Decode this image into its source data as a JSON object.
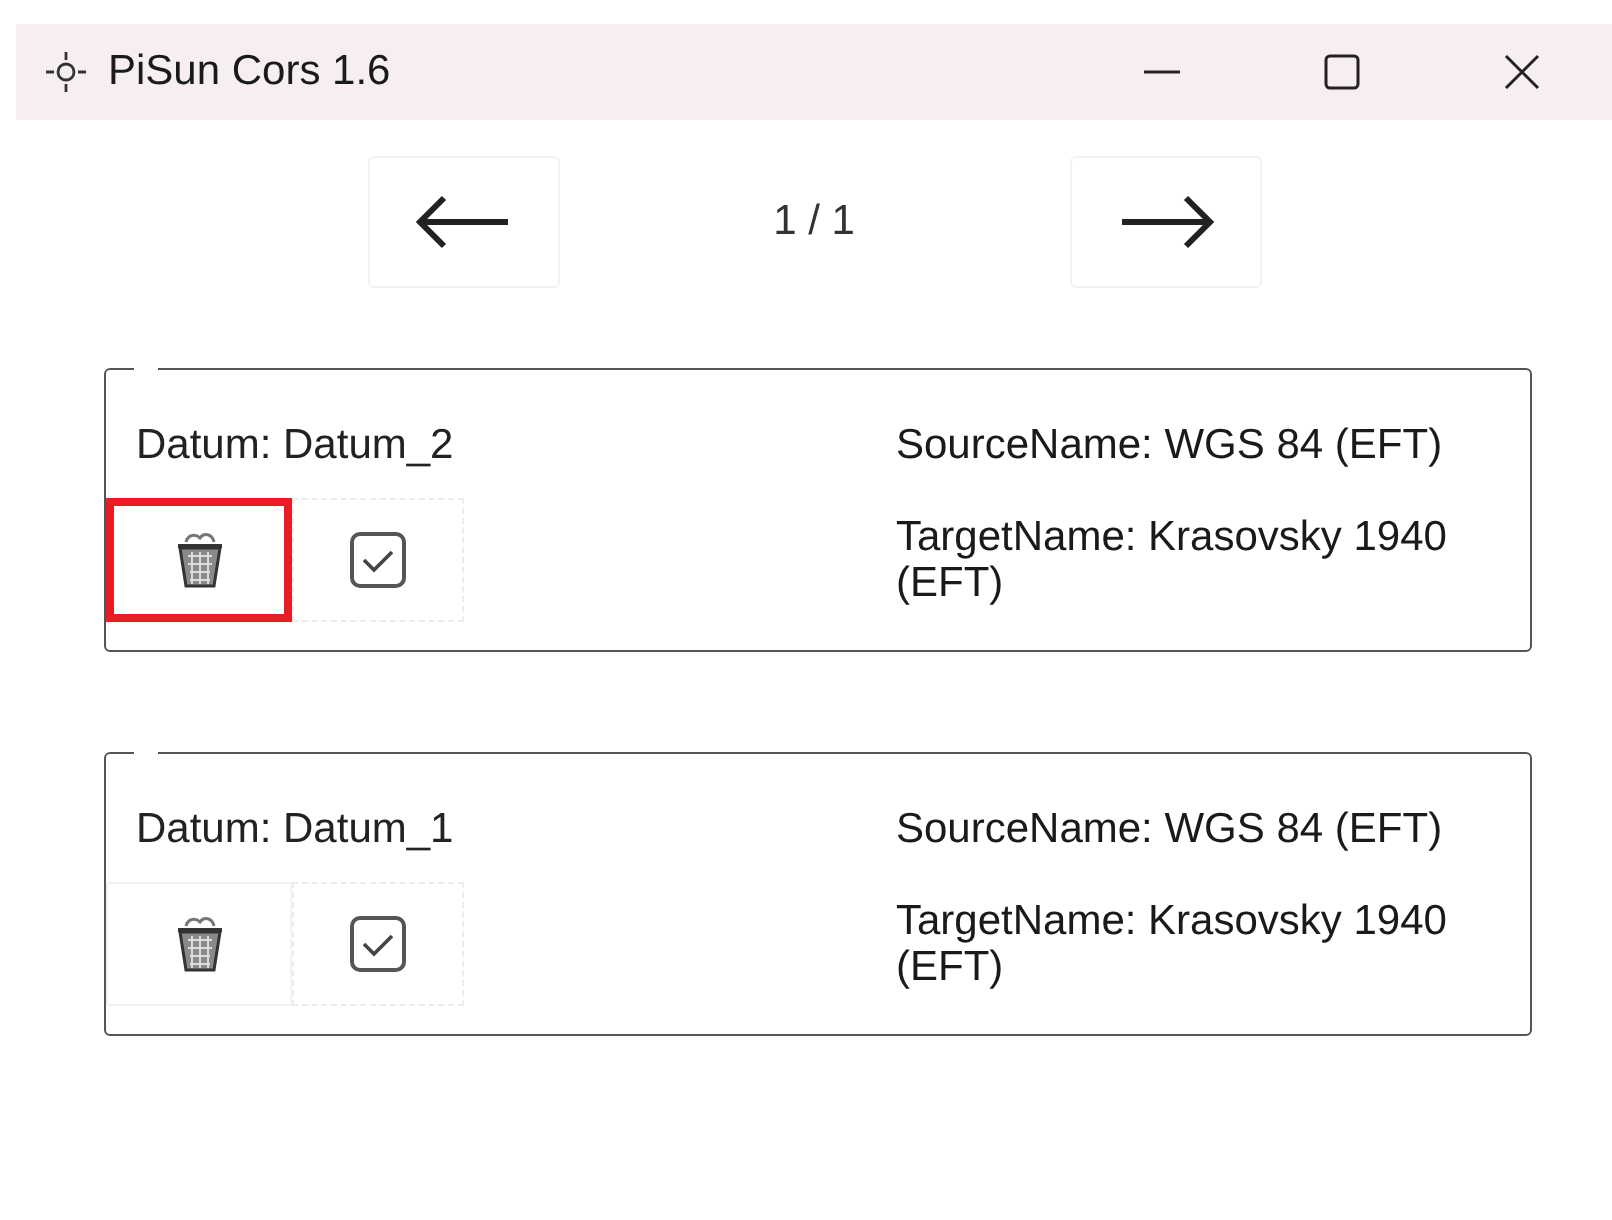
{
  "window": {
    "title": "PiSun Cors 1.6"
  },
  "pager": {
    "page": "1 / 1"
  },
  "datums": [
    {
      "datum": "Datum: Datum_2",
      "source": "SourceName: WGS 84 (EFT)",
      "target": "TargetName: Krasovsky 1940 (EFT)",
      "delete_highlighted": true
    },
    {
      "datum": "Datum: Datum_1",
      "source": "SourceName: WGS 84 (EFT)",
      "target": "TargetName: Krasovsky 1940 (EFT)",
      "delete_highlighted": false
    }
  ]
}
